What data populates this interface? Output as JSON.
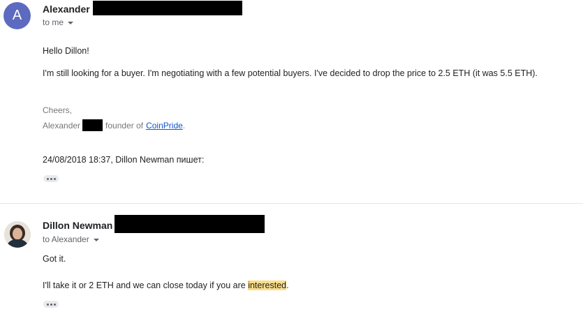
{
  "message1": {
    "avatar_letter": "A",
    "sender_name": "Alexander",
    "recipient": "to me",
    "greeting": "Hello Dillon!",
    "body": "I'm still looking for a buyer. I'm negotiating with a few potential buyers. I've decided to drop the price to 2.5 ETH (it was 5.5 ETH).",
    "signature_line1": "Cheers,",
    "signature_name": "Alexander",
    "signature_founder_text": "founder of",
    "signature_link": "CoinPride",
    "signature_period": ".",
    "quoted_header": "24/08/2018 18:37, Dillon Newman пишет:"
  },
  "message2": {
    "sender_name": "Dillon Newman",
    "recipient": "to Alexander",
    "line1": "Got it.",
    "line2_prefix": "I'll take it or 2 ETH and we can close today if you are ",
    "line2_highlight": "interested",
    "line2_suffix": "."
  },
  "icons": {
    "caret": "chevron-down-icon",
    "trimmed": "ellipsis-icon"
  },
  "colors": {
    "avatar_a": "#5c6bc0",
    "link": "#1155cc",
    "highlight": "#fbdd8a"
  }
}
